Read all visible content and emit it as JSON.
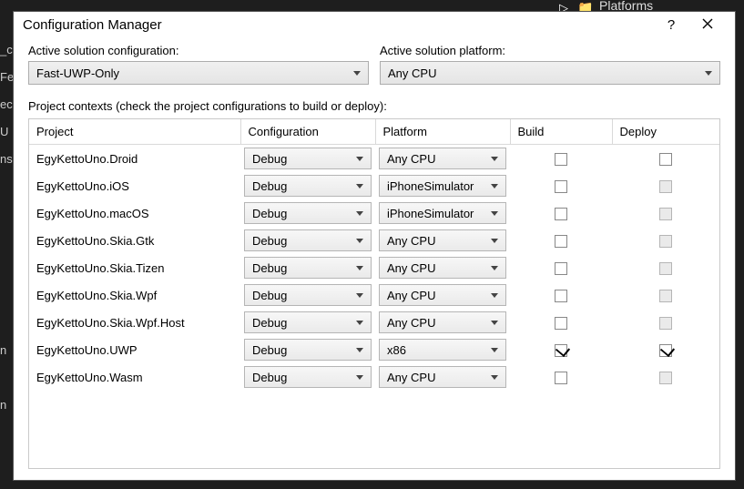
{
  "background": {
    "toolbar_play": "▷",
    "toolbar_folder": "📁",
    "toolbar_text": "Platforms",
    "left_scrap": "_c\nFe\nec\nU\nns\n\n\n\n\n\n\nn\n\nn"
  },
  "dialog": {
    "title": "Configuration Manager",
    "help_icon": "?",
    "close_label": "Close"
  },
  "labels": {
    "active_config": "Active solution configuration:",
    "active_platform": "Active solution platform:",
    "contexts": "Project contexts (check the project configurations to build or deploy):"
  },
  "selection": {
    "active_config": "Fast-UWP-Only",
    "active_platform": "Any CPU"
  },
  "columns": {
    "project": "Project",
    "configuration": "Configuration",
    "platform": "Platform",
    "build": "Build",
    "deploy": "Deploy"
  },
  "rows": [
    {
      "project": "EgyKettoUno.Droid",
      "configuration": "Debug",
      "platform": "Any CPU",
      "build": false,
      "deploy": false,
      "deploy_disabled": false
    },
    {
      "project": "EgyKettoUno.iOS",
      "configuration": "Debug",
      "platform": "iPhoneSimulator",
      "build": false,
      "deploy": false,
      "deploy_disabled": true
    },
    {
      "project": "EgyKettoUno.macOS",
      "configuration": "Debug",
      "platform": "iPhoneSimulator",
      "build": false,
      "deploy": false,
      "deploy_disabled": true
    },
    {
      "project": "EgyKettoUno.Skia.Gtk",
      "configuration": "Debug",
      "platform": "Any CPU",
      "build": false,
      "deploy": false,
      "deploy_disabled": true
    },
    {
      "project": "EgyKettoUno.Skia.Tizen",
      "configuration": "Debug",
      "platform": "Any CPU",
      "build": false,
      "deploy": false,
      "deploy_disabled": true
    },
    {
      "project": "EgyKettoUno.Skia.Wpf",
      "configuration": "Debug",
      "platform": "Any CPU",
      "build": false,
      "deploy": false,
      "deploy_disabled": true
    },
    {
      "project": "EgyKettoUno.Skia.Wpf.Host",
      "configuration": "Debug",
      "platform": "Any CPU",
      "build": false,
      "deploy": false,
      "deploy_disabled": true
    },
    {
      "project": "EgyKettoUno.UWP",
      "configuration": "Debug",
      "platform": "x86",
      "build": true,
      "deploy": true,
      "deploy_disabled": false
    },
    {
      "project": "EgyKettoUno.Wasm",
      "configuration": "Debug",
      "platform": "Any CPU",
      "build": false,
      "deploy": false,
      "deploy_disabled": true
    }
  ]
}
